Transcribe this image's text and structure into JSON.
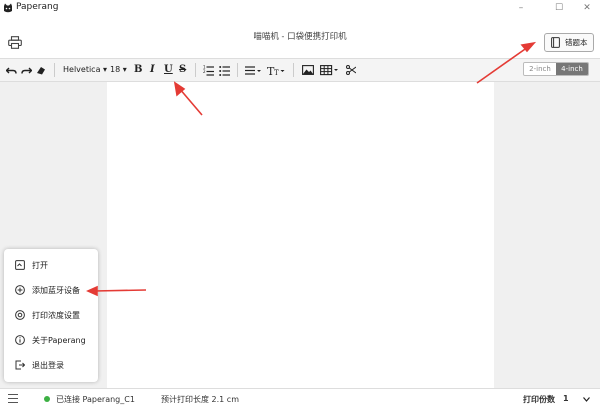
{
  "window": {
    "app_title": "Paperang",
    "minimize": "–",
    "maximize": "☐",
    "close": "✕"
  },
  "header": {
    "doc_title": "喵喵机 - 口袋便携打印机",
    "notebook_label": "错题本"
  },
  "toolbar": {
    "font_family": "Helvetica ▾",
    "font_size": "18 ▾",
    "bold": "B",
    "italic": "I",
    "underline": "U",
    "strike": "S",
    "size_options": [
      "2-inch",
      "4-inch"
    ],
    "active_size": "4-inch"
  },
  "menu": {
    "items": [
      {
        "label": "打开",
        "icon": "folder-open-icon"
      },
      {
        "label": "添加蓝牙设备",
        "icon": "plus-circle-icon"
      },
      {
        "label": "打印浓度设置",
        "icon": "settings-circle-icon"
      },
      {
        "label": "关于Paperang",
        "icon": "info-circle-icon"
      },
      {
        "label": "退出登录",
        "icon": "logout-icon"
      }
    ]
  },
  "status": {
    "connection": "已连接 Paperang_C1",
    "print_length": "预计打印长度 2.1 cm",
    "copies_label": "打印份数",
    "copies_value": "1"
  },
  "colors": {
    "accent_arrow": "#e43b35",
    "connected": "#3cb043",
    "active_toggle": "#777777"
  }
}
